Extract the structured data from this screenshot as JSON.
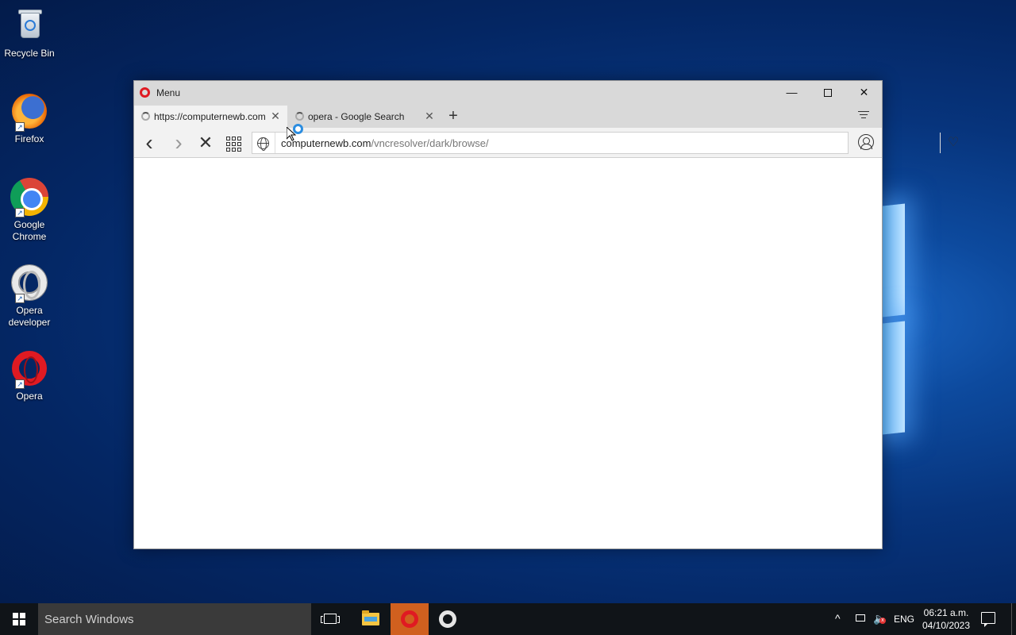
{
  "desktop": {
    "icons": [
      {
        "label": "Recycle Bin",
        "icon": "recycle-bin-icon"
      },
      {
        "label": "Firefox",
        "icon": "firefox-icon"
      },
      {
        "label": "Google Chrome",
        "icon": "chrome-icon"
      },
      {
        "label": "Opera developer",
        "icon": "opera-developer-icon"
      },
      {
        "label": "Opera",
        "icon": "opera-icon"
      }
    ]
  },
  "browser": {
    "menu_label": "Menu",
    "tabs": [
      {
        "title": "https://computernewb.com/vncresolver/dark/browse/",
        "active": true,
        "loading": true
      },
      {
        "title": "opera - Google Search",
        "active": false,
        "loading": true
      }
    ],
    "address": {
      "host": "computernewb.com",
      "path": "/vncresolver/dark/browse/"
    },
    "window_controls": {
      "minimize": "—",
      "close": "✕"
    },
    "glyphs": {
      "back": "‹",
      "forward": "›",
      "stop": "✕",
      "heart": "♡",
      "new_tab": "+",
      "tab_close": "✕"
    }
  },
  "taskbar": {
    "search_placeholder": "Search Windows",
    "tray": {
      "chevron": "^",
      "volume": "🔈",
      "volume_mute": "x",
      "language": "ENG",
      "time": "06:21 a.m.",
      "date": "04/10/2023"
    },
    "accent_color": "#d0601f"
  }
}
